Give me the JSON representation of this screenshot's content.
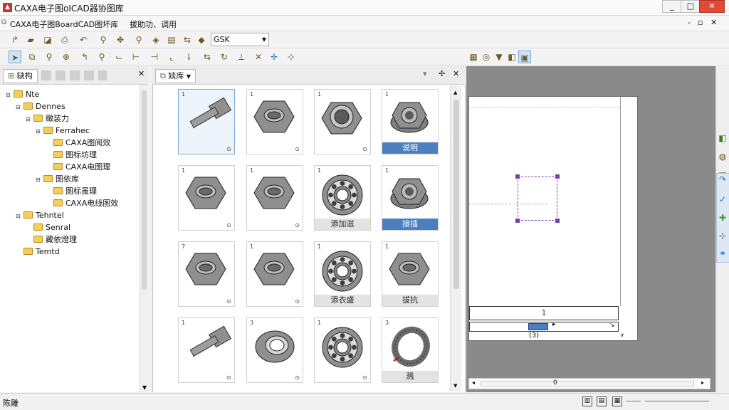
{
  "window": {
    "title": "CAXA电子图oICAD器协图库",
    "btn_min": "_",
    "btn_max": "□",
    "btn_close": "✕"
  },
  "menubar": {
    "doc_title": "CAXA电子图BoardCAD图坏库",
    "extra": "拔助功、调用",
    "right_min": "-",
    "right_restore": "▫",
    "right_close": "✕"
  },
  "toolbar1": {
    "combo_value": "GSK"
  },
  "left_panel": {
    "tab_label": "缺构",
    "close_x": "✕",
    "tree": [
      {
        "label": "Nte",
        "indent": 0,
        "open": true
      },
      {
        "label": "Dennes",
        "indent": 1,
        "open": true
      },
      {
        "label": "緻装力",
        "indent": 2,
        "open": true
      },
      {
        "label": "Ferrahec",
        "indent": 3,
        "open": true
      },
      {
        "label": "CAXA图阅效",
        "indent": 4,
        "open": false
      },
      {
        "label": "图标坊理",
        "indent": 4,
        "open": false
      },
      {
        "label": "CAXA电图理",
        "indent": 4,
        "open": false
      },
      {
        "label": "图依库",
        "indent": 3,
        "open": true
      },
      {
        "label": "图标虽理",
        "indent": 4,
        "open": false
      },
      {
        "label": "CAXA电线图效",
        "indent": 4,
        "open": false
      },
      {
        "label": "Tehntel",
        "indent": 1,
        "open": true
      },
      {
        "label": "Senral",
        "indent": 2,
        "open": false
      },
      {
        "label": "藏依燈理",
        "indent": 2,
        "open": false
      },
      {
        "label": "Temtd",
        "indent": 1,
        "open": false
      }
    ]
  },
  "mid_panel": {
    "tab_label": "婒库",
    "pin": "✢",
    "close": "✕",
    "cards": [
      {
        "num": "1",
        "icon": "bolt-icon",
        "caption": "",
        "cap_style": "",
        "corner": "⊙"
      },
      {
        "num": "1",
        "icon": "hex-nut-icon",
        "caption": "",
        "cap_style": "",
        "corner": "⊙"
      },
      {
        "num": "1",
        "icon": "lock-nut-icon",
        "caption": "",
        "cap_style": "",
        "corner": "⊙"
      },
      {
        "num": "1",
        "icon": "flange-nut-icon",
        "caption": "说明",
        "cap_style": "blue",
        "corner": ""
      },
      {
        "num": "1",
        "icon": "hex-nut-icon",
        "caption": "",
        "cap_style": "",
        "corner": "⊙"
      },
      {
        "num": "1",
        "icon": "hex-nut-icon",
        "caption": "",
        "cap_style": "",
        "corner": "⊙"
      },
      {
        "num": "1",
        "icon": "bearing-icon",
        "caption": "添加滋",
        "cap_style": "gray",
        "corner": ""
      },
      {
        "num": "1",
        "icon": "flange-nut-icon",
        "caption": "接插",
        "cap_style": "blue",
        "corner": ""
      },
      {
        "num": "7",
        "icon": "hex-nut-icon",
        "caption": "",
        "cap_style": "",
        "corner": "⊙"
      },
      {
        "num": "1",
        "icon": "hex-nut-icon",
        "caption": "",
        "cap_style": "",
        "corner": "⊙"
      },
      {
        "num": "1",
        "icon": "bearing-icon",
        "caption": "添衣盛",
        "cap_style": "gray",
        "corner": ""
      },
      {
        "num": "1",
        "icon": "hex-nut-icon",
        "caption": "拔抗",
        "cap_style": "gray",
        "corner": ""
      },
      {
        "num": "1",
        "icon": "bolt-icon",
        "caption": "",
        "cap_style": "",
        "corner": "⊙"
      },
      {
        "num": "3",
        "icon": "ring-icon",
        "caption": "",
        "cap_style": "",
        "corner": "⊙"
      },
      {
        "num": "1",
        "icon": "bearing-icon",
        "caption": "",
        "cap_style": "",
        "corner": "⊙"
      },
      {
        "num": "3",
        "icon": "spring-ring-icon",
        "caption": "溅",
        "cap_style": "gray",
        "corner": ""
      }
    ]
  },
  "drawing": {
    "title_block_label": "1",
    "scale_label": "(3)",
    "hscroll_value": "0"
  },
  "status": {
    "left_text": "陈雕"
  },
  "colors": {
    "accent": "#4a7fc0",
    "selection": "#7a3fa8",
    "canvas_bg": "#8a8a8a"
  }
}
